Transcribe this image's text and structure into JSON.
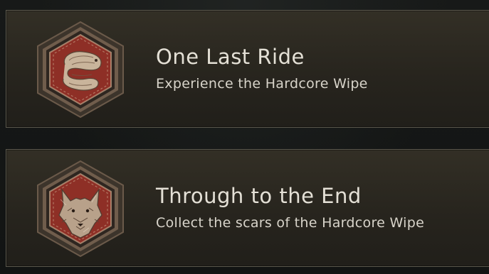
{
  "achievements": [
    {
      "title": "One Last Ride",
      "description": "Experience the Hardcore Wipe",
      "icon": "snake-emblem-icon"
    },
    {
      "title": "Through to the End",
      "description": "Collect the scars of the Hardcore Wipe",
      "icon": "wolf-emblem-icon"
    }
  ],
  "colors": {
    "card_border": "#5a574c",
    "emblem_red": "#8e2f26",
    "emblem_frame": "#b49a80",
    "title_text": "#e4e0d6"
  }
}
